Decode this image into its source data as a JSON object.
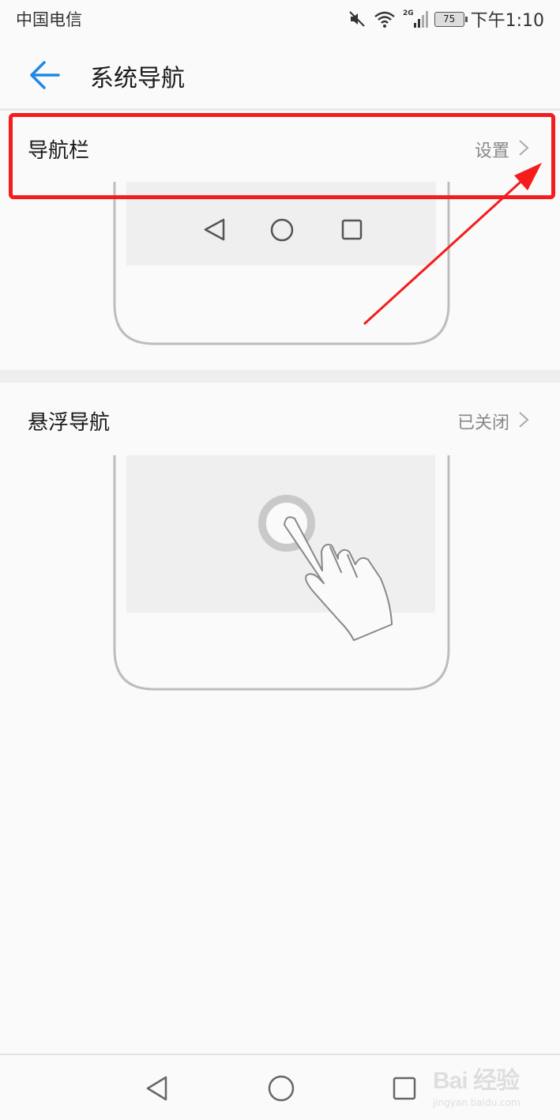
{
  "status_bar": {
    "carrier": "中国电信",
    "network": "2G",
    "battery": "75",
    "time": "下午1:10"
  },
  "app_bar": {
    "title": "系统导航",
    "back_icon": "arrow-left-icon"
  },
  "settings": [
    {
      "label": "导航栏",
      "value": "设置"
    },
    {
      "label": "悬浮导航",
      "value": "已关闭"
    }
  ],
  "nav_bar": {
    "icons": [
      "triangle-back-icon",
      "circle-home-icon",
      "square-recents-icon"
    ]
  },
  "watermark": {
    "brand": "Bai 经验",
    "url": "jingyan.baidu.com"
  },
  "colors": {
    "accent": "#1e88e5",
    "annotation": "#f41c1c",
    "text_primary": "#1a1a1a",
    "text_secondary": "#888888",
    "illustration_line": "#bdbdbd",
    "illustration_fill": "#efefef"
  }
}
